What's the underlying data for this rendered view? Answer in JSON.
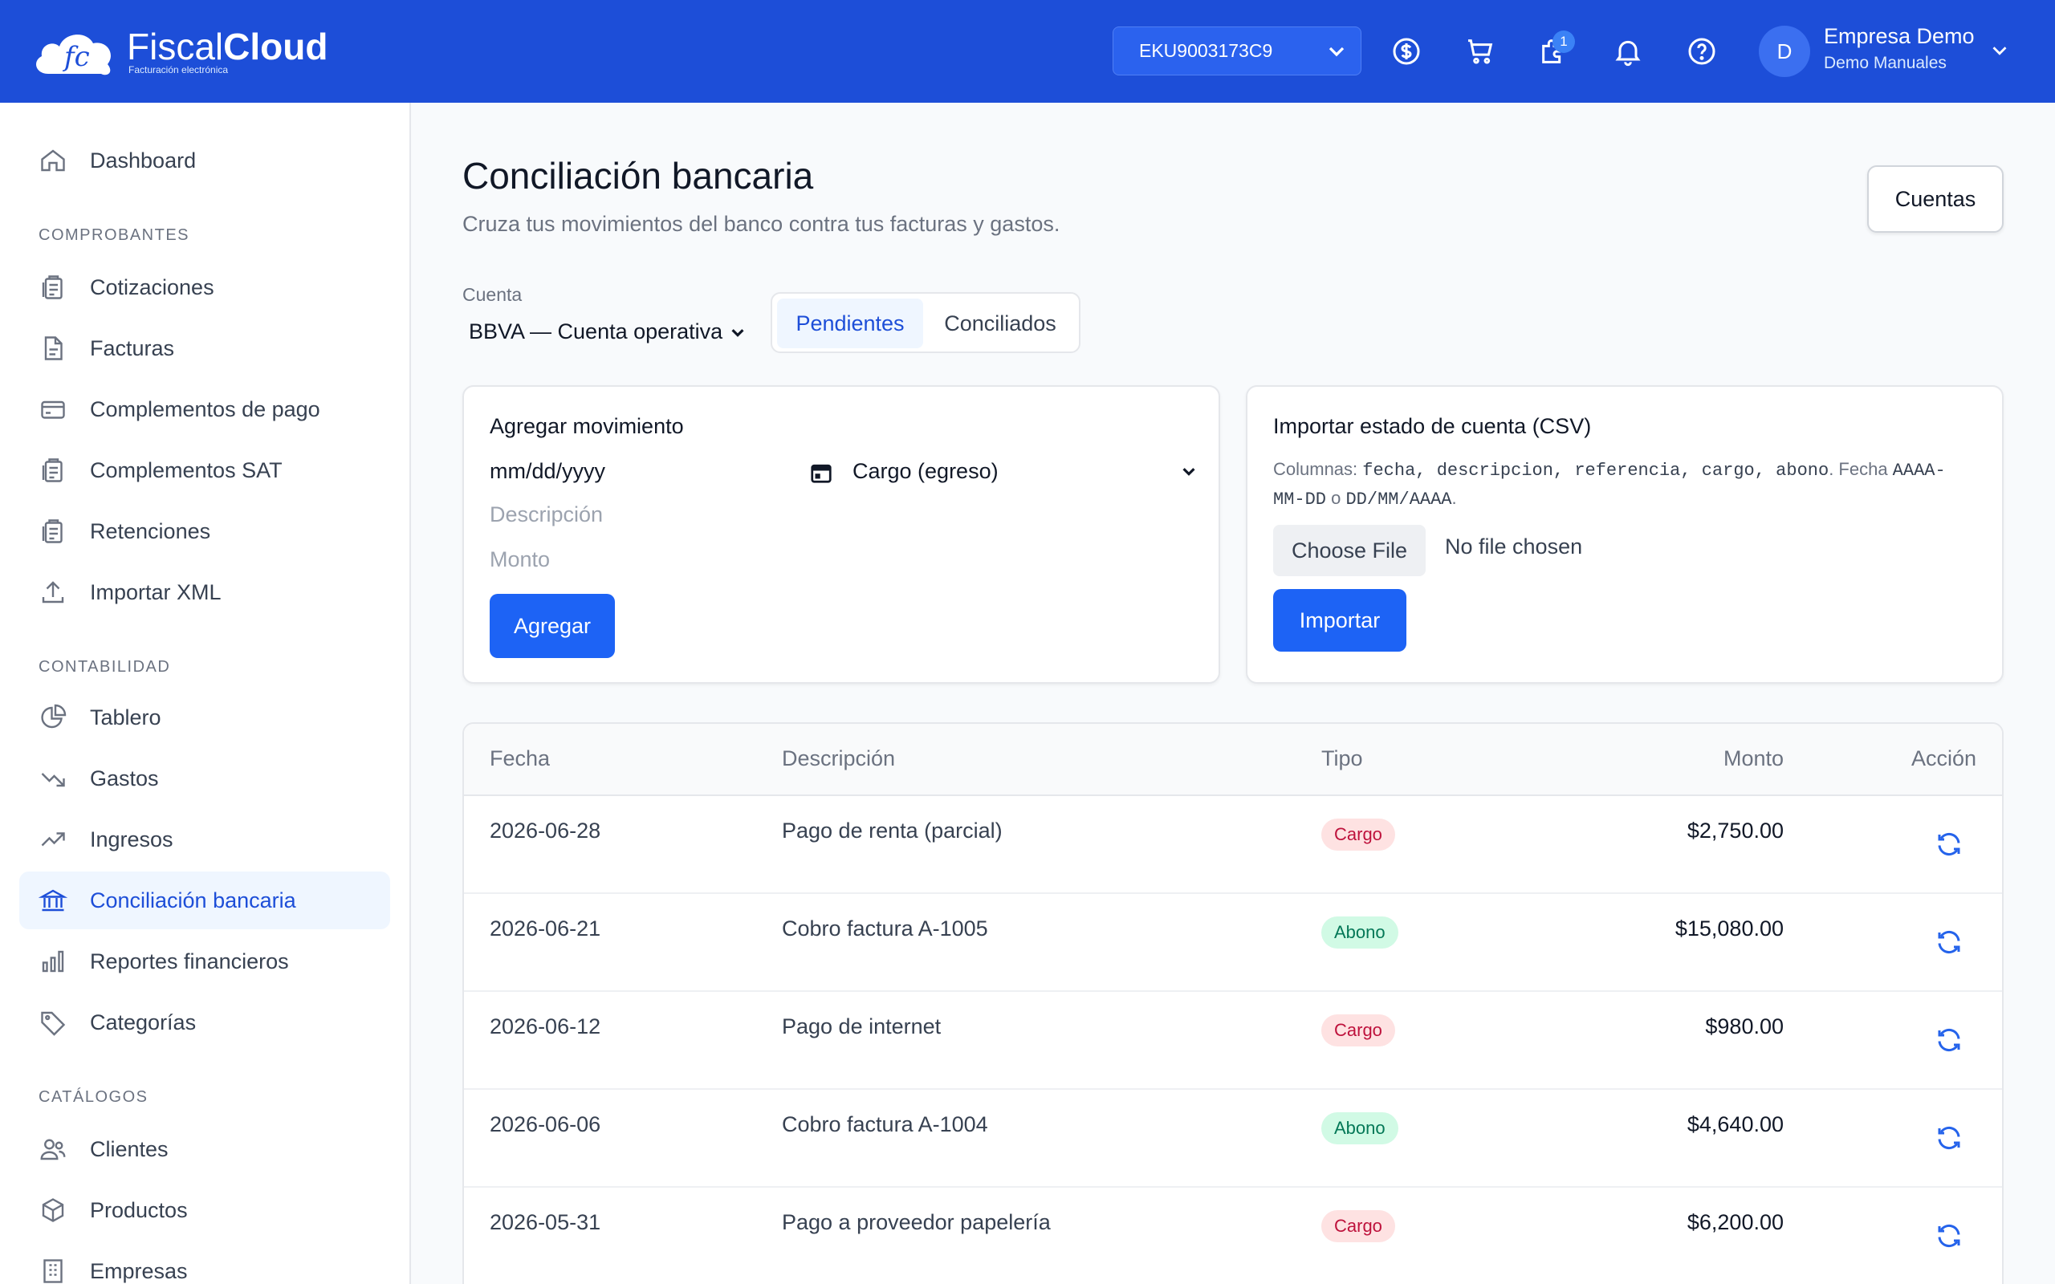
{
  "brand": {
    "name_light": "Fiscal",
    "name_bold": "Cloud",
    "tagline": "Facturación electrónica",
    "color": "#1d4ed8"
  },
  "header": {
    "rfc": "EKU9003173C9",
    "notification_badge": "1",
    "avatar_initial": "D",
    "user_name": "Empresa Demo",
    "user_sub": "Demo Manuales",
    "icons": [
      "dollar-icon",
      "cart-icon",
      "puzzle-icon",
      "bell-icon",
      "help-icon"
    ]
  },
  "sidebar": {
    "dashboard": "Dashboard",
    "sections": {
      "comprobantes": "COMPROBANTES",
      "contabilidad": "CONTABILIDAD",
      "catalogos": "CATÁLOGOS"
    },
    "comprobantes": [
      "Cotizaciones",
      "Facturas",
      "Complementos de pago",
      "Complementos SAT",
      "Retenciones",
      "Importar XML"
    ],
    "contabilidad": [
      "Tablero",
      "Gastos",
      "Ingresos",
      "Conciliación bancaria",
      "Reportes financieros",
      "Categorías"
    ],
    "catalogos": [
      "Clientes",
      "Productos",
      "Empresas"
    ]
  },
  "page": {
    "title": "Conciliación bancaria",
    "subtitle": "Cruza tus movimientos del banco contra tus facturas y gastos.",
    "cuentas_button": "Cuentas",
    "cuenta_label": "Cuenta",
    "cuenta_value": "BBVA — Cuenta operativa",
    "tabs": [
      "Pendientes",
      "Conciliados"
    ]
  },
  "add_card": {
    "title": "Agregar movimiento",
    "date_placeholder": "mm/dd/yyyy",
    "type_value": "Cargo (egreso)",
    "description_placeholder": "Descripción",
    "amount_placeholder": "Monto",
    "submit": "Agregar"
  },
  "import_card": {
    "title": "Importar estado de cuenta (CSV)",
    "help_prefix": "Columnas: ",
    "columns": "fecha, descripcion, referencia, cargo, abono",
    "help_mid": ". Fecha ",
    "format1": "AAAA-MM-DD",
    "help_or": " o ",
    "format2": "DD/MM/AAAA",
    "help_end": ".",
    "choose_file": "Choose File",
    "no_file": "No file chosen",
    "submit": "Importar"
  },
  "table": {
    "headers": {
      "fecha": "Fecha",
      "descripcion": "Descripción",
      "tipo": "Tipo",
      "monto": "Monto",
      "accion": "Acción"
    },
    "rows": [
      {
        "fecha": "2026-06-28",
        "descripcion": "Pago de renta (parcial)",
        "tipo": "Cargo",
        "monto": "$2,750.00"
      },
      {
        "fecha": "2026-06-21",
        "descripcion": "Cobro factura A-1005",
        "tipo": "Abono",
        "monto": "$15,080.00"
      },
      {
        "fecha": "2026-06-12",
        "descripcion": "Pago de internet",
        "tipo": "Cargo",
        "monto": "$980.00"
      },
      {
        "fecha": "2026-06-06",
        "descripcion": "Cobro factura A-1004",
        "tipo": "Abono",
        "monto": "$4,640.00"
      },
      {
        "fecha": "2026-05-31",
        "descripcion": "Pago a proveedor papelería",
        "tipo": "Cargo",
        "monto": "$6,200.00"
      }
    ]
  }
}
